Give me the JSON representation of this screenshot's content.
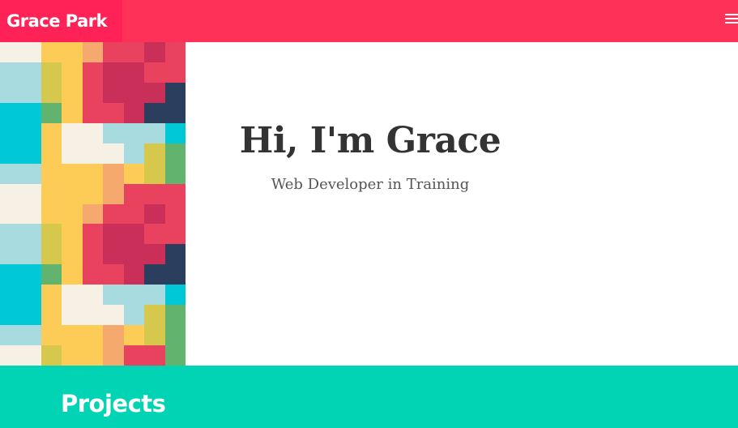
{
  "nav": {
    "brand": "Grace Park",
    "menu_icon": "hamburger-menu-icon"
  },
  "hero": {
    "title": "Hi, I'm Grace",
    "subtitle": "Web Developer in Training"
  },
  "projects": {
    "heading": "Projects"
  },
  "colors": {
    "nav": "#fe3159",
    "brand": "#fe2257",
    "projects": "#00d4b4",
    "text_dark": "#333333"
  },
  "mosaic_palette": [
    "#e8425f",
    "#c92f58",
    "#fccc57",
    "#00c8d7",
    "#f6f1e4",
    "#62b36d",
    "#2c3e5e",
    "#a8dbe0",
    "#d6c84c",
    "#f6a96f"
  ]
}
